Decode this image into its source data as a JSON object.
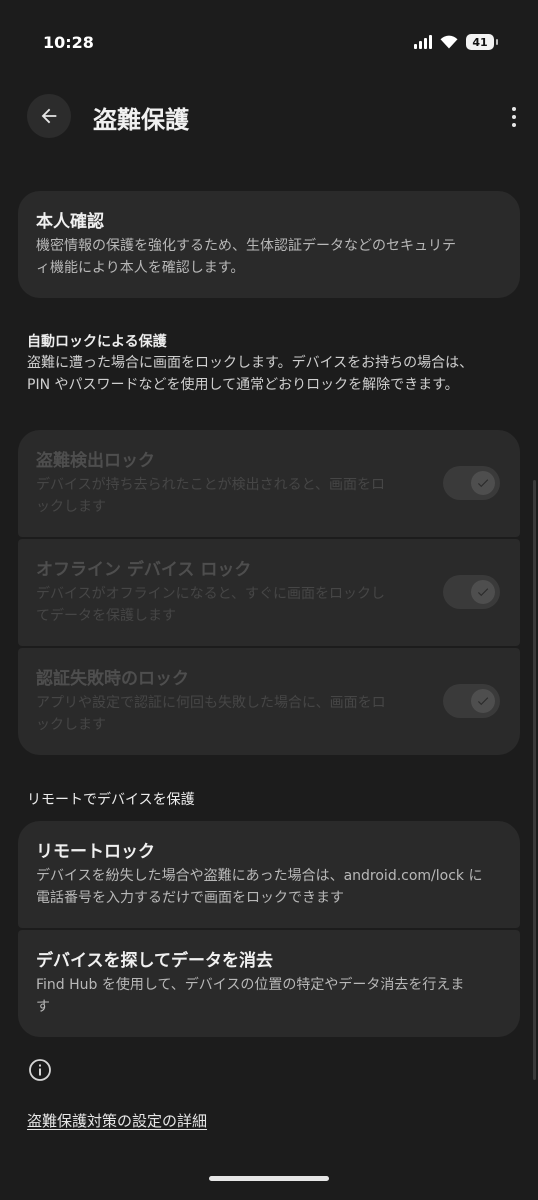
{
  "status_bar": {
    "time": "10:28",
    "battery": "41"
  },
  "app_bar": {
    "back_icon": "arrow-left-icon",
    "title": "盗難保護",
    "overflow_icon": "more-vert-icon"
  },
  "identity_card": {
    "title": "本人確認",
    "description": "機密情報の保護を強化するため、生体認証データなどのセキュリティ機能により本人を確認します。"
  },
  "auto_lock_section": {
    "title": "自動ロックによる保護",
    "description": "盗難に遭った場合に画面をロックします。デバイスをお持ちの場合は、PIN やパスワードなどを使用して通常どおりロックを解除できます。",
    "items": [
      {
        "title": "盗難検出ロック",
        "description": "デバイスが持ち去られたことが検出されると、画面をロックします",
        "enabled": false,
        "checked": true
      },
      {
        "title": "オフライン デバイス ロック",
        "description": "デバイスがオフラインになると、すぐに画面をロックしてデータを保護します",
        "enabled": false,
        "checked": true
      },
      {
        "title": "認証失敗時のロック",
        "description": "アプリや設定で認証に何回も失敗した場合に、画面をロックします",
        "enabled": false,
        "checked": true
      }
    ]
  },
  "remote_section": {
    "title": "リモートでデバイスを保護",
    "items": [
      {
        "title": "リモートロック",
        "description": "デバイスを紛失した場合や盗難にあった場合は、android.com/lock に電話番号を入力するだけで画面をロックできます"
      },
      {
        "title": "デバイスを探してデータを消去",
        "description": "Find Hub を使用して、デバイスの位置の特定やデータ消去を行えます"
      }
    ]
  },
  "footer": {
    "info_icon": "info-icon",
    "link": "盗難保護対策の設定の詳細"
  },
  "colors": {
    "background": "#1c1c1c",
    "card": "#2a2a2a",
    "disabled_text": "#4e4e4e"
  }
}
